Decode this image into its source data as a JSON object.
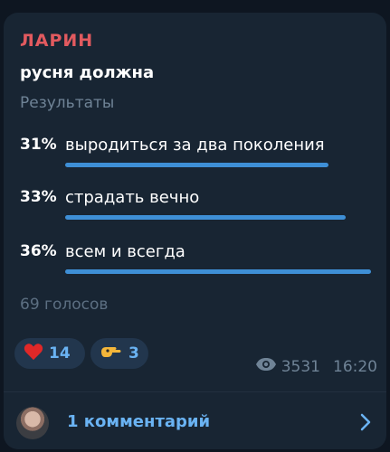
{
  "post": {
    "sender": "ЛАРИН",
    "question": "русня должна",
    "results_label": "Результаты",
    "options": [
      {
        "percent": "31%",
        "text": "выродиться за два поколения",
        "fill": 0.31
      },
      {
        "percent": "33%",
        "text": "страдать вечно",
        "fill": 0.33
      },
      {
        "percent": "36%",
        "text": "всем и всегда",
        "fill": 0.36
      }
    ],
    "votes": "69 голосов"
  },
  "reactions": [
    {
      "icon": "heart-icon",
      "count": "14"
    },
    {
      "icon": "pointing-hand-icon",
      "count": "3"
    }
  ],
  "meta": {
    "views": "3531",
    "time": "16:20"
  },
  "comments": {
    "label": "1 комментарий"
  },
  "colors": {
    "accent": "#3e8fd6",
    "sender": "#e25a5f",
    "link": "#6ab3f3",
    "bubble": "#182533",
    "background": "#0e1621"
  }
}
